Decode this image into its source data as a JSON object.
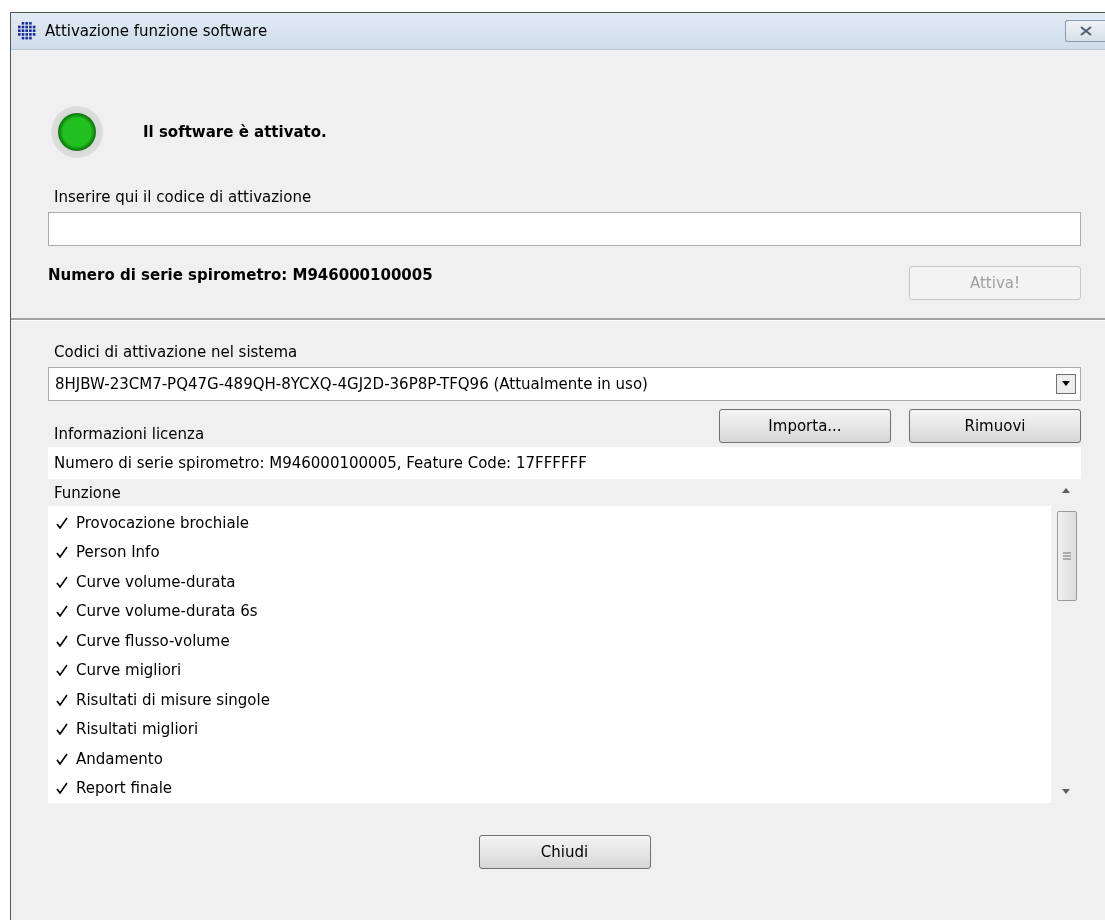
{
  "window": {
    "title": "Attivazione funzione software"
  },
  "status": {
    "activated": true,
    "text": "Il software è attivato."
  },
  "activation_code": {
    "label": "Inserire qui il codice di attivazione"
  },
  "serial_number": "Numero di serie spirometro: M946000100005",
  "activate_button": {
    "label": "Attiva!",
    "disabled": true
  },
  "system_codes": {
    "label": "Codici di attivazione nel sistema",
    "value": "8HJBW-23CM7-PQ47G-489QH-8YCXQ-4GJ2D-36P8P-TFQ96 (Attualmente in uso)"
  },
  "code_buttons": [
    "Importa...",
    "Rimuovi"
  ],
  "license": {
    "label": "Informazioni licenza",
    "info": "Numero di serie spirometro: M946000100005, Feature Code: 17FFFFFF"
  },
  "functions": {
    "column": "Funzione",
    "items": [
      {
        "label": "Provocazione brochiale",
        "checked": true
      },
      {
        "label": "Person Info",
        "checked": true
      },
      {
        "label": "Curve volume-durata",
        "checked": true
      },
      {
        "label": "Curve volume-durata 6s",
        "checked": true
      },
      {
        "label": "Curve flusso-volume",
        "checked": true
      },
      {
        "label": "Curve migliori",
        "checked": true
      },
      {
        "label": "Risultati di misure singole",
        "checked": true
      },
      {
        "label": "Risultati migliori",
        "checked": true
      },
      {
        "label": "Andamento",
        "checked": true
      },
      {
        "label": "Report finale",
        "checked": true
      }
    ]
  },
  "close_button": "Chiudi"
}
